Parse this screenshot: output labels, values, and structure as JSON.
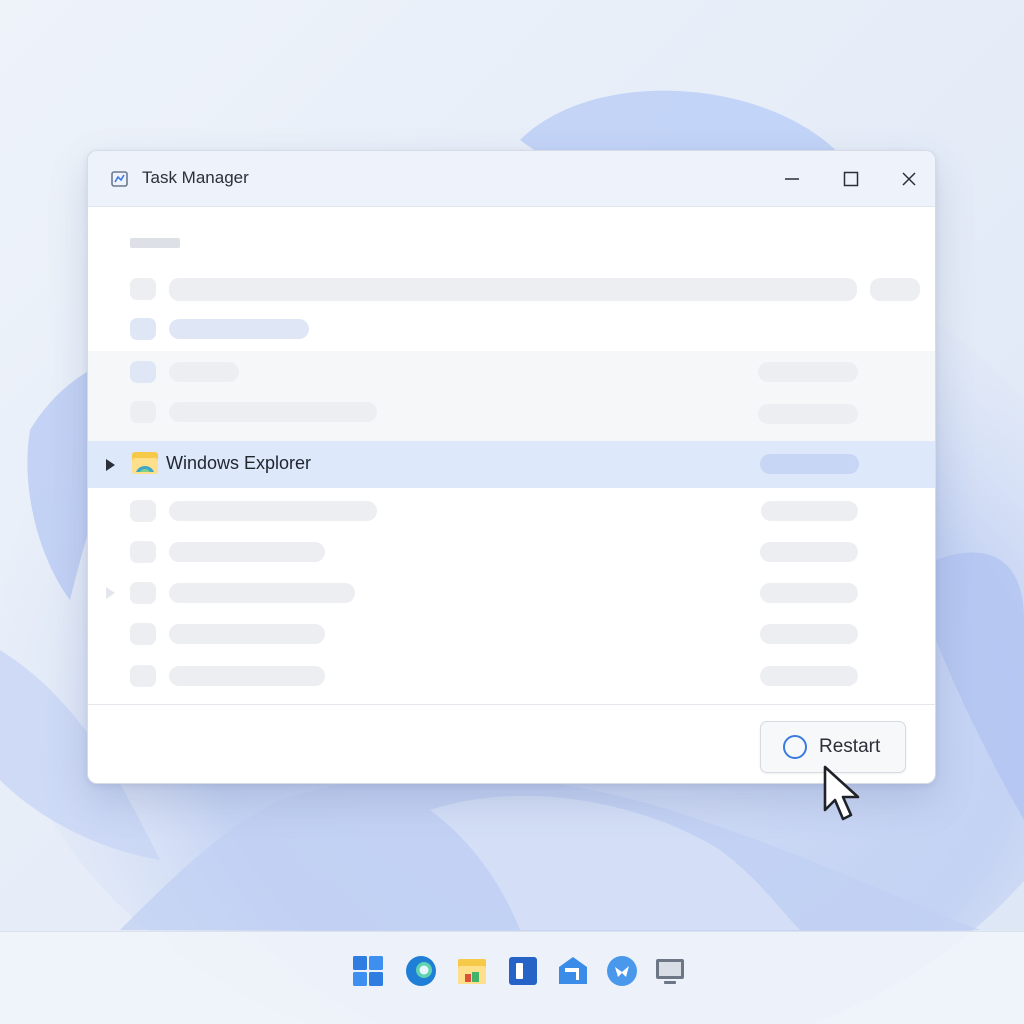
{
  "window": {
    "title": "Task Manager"
  },
  "selected_process": {
    "name": "Windows Explorer"
  },
  "actions": {
    "restart_label": "Restart"
  },
  "colors": {
    "accent": "#3b7be0",
    "selection": "#dde8fb",
    "placeholder": "#eceef2"
  },
  "taskbar": {
    "icons": [
      "start-icon",
      "edge-icon",
      "file-explorer-icon",
      "widgets-icon",
      "store-icon",
      "teams-icon",
      "monitor-icon"
    ]
  }
}
